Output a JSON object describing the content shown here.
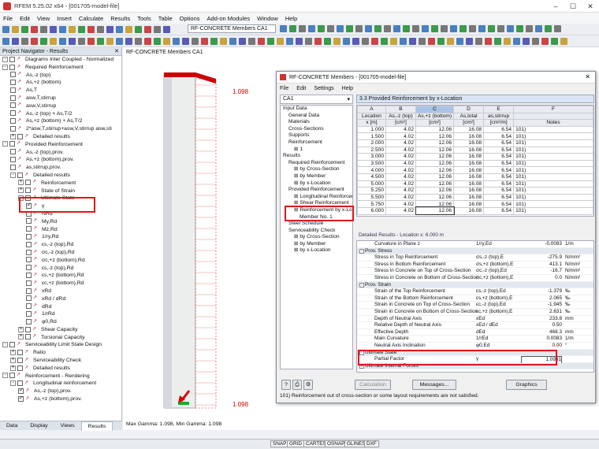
{
  "window": {
    "title": "RFEM 5.25.02 x64 - [001705-model-file]"
  },
  "menu": [
    "File",
    "Edit",
    "View",
    "Insert",
    "Calculate",
    "Results",
    "Tools",
    "Table",
    "Options",
    "Add-on Modules",
    "Window",
    "Help"
  ],
  "toolbar": {
    "module_combo": "RF-CONCRETE Members CA1"
  },
  "navigator": {
    "title": "Project Navigator - Results",
    "items": [
      {
        "d": 0,
        "exp": "-",
        "label": "Diagrams Inter Coupled - Normalized"
      },
      {
        "d": 0,
        "exp": "-",
        "label": "Required Reinforcement"
      },
      {
        "d": 1,
        "cb": false,
        "label": "As,-z (top)"
      },
      {
        "d": 1,
        "cb": false,
        "label": "As,+z (bottom)"
      },
      {
        "d": 1,
        "cb": false,
        "label": "As,T"
      },
      {
        "d": 1,
        "cb": false,
        "label": "asw,T,stirrup"
      },
      {
        "d": 1,
        "cb": false,
        "label": "asw,V,stirrup"
      },
      {
        "d": 1,
        "cb": false,
        "label": "As,-z (top) + As,T/2"
      },
      {
        "d": 1,
        "cb": false,
        "label": "As,+z (bottom) + As,T/2"
      },
      {
        "d": 1,
        "cb": false,
        "label": "2*asw,T,stirrup+asw,V,stirrup asw,sti"
      },
      {
        "d": 1,
        "exp": "+",
        "label": "Detailed results"
      },
      {
        "d": 0,
        "exp": "-",
        "label": "Provided Reinforcement"
      },
      {
        "d": 1,
        "cb": false,
        "label": "As,-z (top),prov."
      },
      {
        "d": 1,
        "cb": false,
        "label": "As,+z (bottom),prov."
      },
      {
        "d": 1,
        "cb": false,
        "label": "as,stirrup,prov."
      },
      {
        "d": 1,
        "exp": "-",
        "label": "Detailed results"
      },
      {
        "d": 2,
        "exp": "+",
        "label": "Reinforcement"
      },
      {
        "d": 2,
        "exp": "+",
        "label": "State of Strain"
      },
      {
        "d": 2,
        "exp": "-",
        "label": "Ultimate State"
      },
      {
        "d": 3,
        "cb": true,
        "label": "γ"
      },
      {
        "d": 3,
        "cb": false,
        "label": "NRd"
      },
      {
        "d": 3,
        "cb": false,
        "label": "My,Rd"
      },
      {
        "d": 3,
        "cb": false,
        "label": "Mz,Rd"
      },
      {
        "d": 3,
        "cb": false,
        "label": "1/ry,Rd"
      },
      {
        "d": 3,
        "cb": false,
        "label": "εs,-z (top),Rd"
      },
      {
        "d": 3,
        "cb": false,
        "label": "σc,-z (top),Rd"
      },
      {
        "d": 3,
        "cb": false,
        "label": "σc,+z (bottom),Rd"
      },
      {
        "d": 3,
        "cb": false,
        "label": "εs,-z (top),Rd"
      },
      {
        "d": 3,
        "cb": false,
        "label": "εs,+z (bottom),Rd"
      },
      {
        "d": 3,
        "cb": false,
        "label": "εc,+z (bottom),Rd"
      },
      {
        "d": 3,
        "cb": false,
        "label": "xRd"
      },
      {
        "d": 3,
        "cb": false,
        "label": "xRd / dRd"
      },
      {
        "d": 3,
        "cb": false,
        "label": "dRd"
      },
      {
        "d": 3,
        "cb": false,
        "label": "1/rRd"
      },
      {
        "d": 3,
        "cb": false,
        "label": "φ0,Rd"
      },
      {
        "d": 2,
        "exp": "+",
        "label": "Shear Capacity"
      },
      {
        "d": 2,
        "exp": "+",
        "label": "Torsional Capacity"
      },
      {
        "d": 0,
        "exp": "-",
        "label": "Serviceability Limit State Design"
      },
      {
        "d": 1,
        "exp": "+",
        "label": "Ratio"
      },
      {
        "d": 1,
        "exp": "+",
        "label": "Serviceability Check"
      },
      {
        "d": 1,
        "exp": "+",
        "label": "Detailed results"
      },
      {
        "d": 0,
        "exp": "-",
        "label": "Reinforcement - Rendering"
      },
      {
        "d": 1,
        "exp": "-",
        "label": "Longitudinal reinforcement"
      },
      {
        "d": 2,
        "cb": true,
        "label": "As,-z (top),prov."
      },
      {
        "d": 2,
        "cb": true,
        "label": "As,+z (bottom),prov."
      }
    ],
    "tabs": [
      "Data",
      "Display",
      "Views",
      "Results"
    ]
  },
  "workspace": {
    "label": "RF-CONCRETE Members CA1",
    "top_value": "1.098",
    "bottom_value": "1.098",
    "footer": "Max Gamma: 1.098, Min Gamma: 1.098"
  },
  "dialog": {
    "title": "RF-CONCRETE Members - [001705-model-file]",
    "menu": [
      "File",
      "Edit",
      "Settings",
      "Help"
    ],
    "case": "CA1",
    "tree": [
      {
        "d": 0,
        "t": "Input Data"
      },
      {
        "d": 1,
        "t": "General Data"
      },
      {
        "d": 1,
        "t": "Materials"
      },
      {
        "d": 1,
        "t": "Cross-Sections"
      },
      {
        "d": 1,
        "t": "Supports"
      },
      {
        "d": 1,
        "t": "Reinforcement"
      },
      {
        "d": 2,
        "t": "1"
      },
      {
        "d": 0,
        "t": "Results"
      },
      {
        "d": 1,
        "t": "Required Reinforcement"
      },
      {
        "d": 2,
        "t": "by Cross-Section"
      },
      {
        "d": 2,
        "t": "by Member"
      },
      {
        "d": 2,
        "t": "by x-Location"
      },
      {
        "d": 1,
        "t": "Provided Reinforcement"
      },
      {
        "d": 2,
        "t": "Longitudinal Reinforcement"
      },
      {
        "d": 2,
        "t": "Shear Reinforcement"
      },
      {
        "d": 2,
        "t": "Reinforcement by x-Locatio"
      },
      {
        "d": 3,
        "t": "Member No. 1"
      },
      {
        "d": 1,
        "t": "Steel Schedule"
      },
      {
        "d": 1,
        "t": "Serviceability Check"
      },
      {
        "d": 2,
        "t": "by Cross-Section"
      },
      {
        "d": 2,
        "t": "by Member"
      },
      {
        "d": 2,
        "t": "by x-Location"
      }
    ],
    "table_title": "3.3 Provided Reinforcement by x-Location",
    "col_letters": [
      "A",
      "B",
      "C",
      "D",
      "E",
      "F"
    ],
    "col_headers": [
      [
        "Location",
        "x [m]"
      ],
      [
        "As,-z (top)",
        "[cm²]"
      ],
      [
        "As,+z (bottom)",
        "[cm²]"
      ],
      [
        "As,total",
        "[cm²]"
      ],
      [
        "as,stirrup",
        "[cm²/m]"
      ],
      [
        "",
        "Notes"
      ]
    ],
    "rows": [
      [
        "1.000",
        "4.02",
        "12.06",
        "16.08",
        "6.54",
        "101)"
      ],
      [
        "1.500",
        "4.02",
        "12.06",
        "16.08",
        "6.54",
        "101)"
      ],
      [
        "2.000",
        "4.02",
        "12.06",
        "16.08",
        "6.54",
        "101)"
      ],
      [
        "2.500",
        "4.02",
        "12.06",
        "16.08",
        "6.54",
        "101)"
      ],
      [
        "3.000",
        "4.02",
        "12.06",
        "16.08",
        "6.54",
        "101)"
      ],
      [
        "3.500",
        "4.02",
        "12.06",
        "16.08",
        "6.54",
        "101)"
      ],
      [
        "4.000",
        "4.02",
        "12.06",
        "16.08",
        "6.54",
        "101)"
      ],
      [
        "4.500",
        "4.02",
        "12.06",
        "16.08",
        "6.54",
        "101)"
      ],
      [
        "5.000",
        "4.02",
        "12.06",
        "16.08",
        "6.54",
        "101)"
      ],
      [
        "5.250",
        "4.02",
        "12.06",
        "16.08",
        "6.54",
        "101)"
      ],
      [
        "5.500",
        "4.02",
        "12.06",
        "16.08",
        "6.54",
        "101)"
      ],
      [
        "5.750",
        "4.02",
        "12.06",
        "16.08",
        "6.54",
        "101)"
      ],
      [
        "6.000",
        "4.02",
        "12.06",
        "16.08",
        "6.54",
        "101)"
      ]
    ],
    "details_header": "Detailed Results  -  Location x: 6.000 m",
    "details": [
      {
        "g": false,
        "n": "Curvature in Plane z",
        "s": "1/ry,Ed",
        "v": "-0.0083",
        "u": "1/m"
      },
      {
        "g": true,
        "n": "Prov. Stress"
      },
      {
        "g": false,
        "n": "Stress in Top Reinforcement",
        "s": "σs,-z (top),E",
        "v": "-275.9",
        "u": "N/mm²"
      },
      {
        "g": false,
        "n": "Stress in Bottom Reinforcement",
        "s": "σs,+z (bottom),E",
        "v": "413.1",
        "u": "N/mm²"
      },
      {
        "g": false,
        "n": "Stress in Concrete on Top of Cross-Section",
        "s": "σc,-z (top),Ed",
        "v": "-16.7",
        "u": "N/mm²"
      },
      {
        "g": false,
        "n": "Stress in Concrete on Bottom of Cross-Section",
        "s": "σc,+z (bottom),E",
        "v": "0.0",
        "u": "N/mm²"
      },
      {
        "g": true,
        "n": "Prov. Strain"
      },
      {
        "g": false,
        "n": "Strain of the Top Reinforcement",
        "s": "εs,-z (top),Ed",
        "v": "-1.379",
        "u": "‰"
      },
      {
        "g": false,
        "n": "Strain of the Bottom Reinforcement",
        "s": "εs,+z (bottom),E",
        "v": "2.065",
        "u": "‰"
      },
      {
        "g": false,
        "n": "Strain in Concrete on Top of Cross-Section",
        "s": "εc,-z (top),Ed",
        "v": "-1.945",
        "u": "‰"
      },
      {
        "g": false,
        "n": "Strain in Concrete on Bottom of Cross-Section",
        "s": "εc,+z (bottom),E",
        "v": "2.631",
        "u": "‰"
      },
      {
        "g": false,
        "n": "Depth of Neutral Axis",
        "s": "xEd",
        "v": "233.8",
        "u": "mm"
      },
      {
        "g": false,
        "n": "Relative Depth of Neutral Axis",
        "s": "xEd / dEd",
        "v": "0.50",
        "u": ""
      },
      {
        "g": false,
        "n": "Effective Depth",
        "s": "dEd",
        "v": "468.3",
        "u": "mm"
      },
      {
        "g": false,
        "n": "Main Curvature",
        "s": "1/rEd",
        "v": "0.0083",
        "u": "1/m"
      },
      {
        "g": false,
        "n": "Neutral Axis Inclination",
        "s": "φ0,Ed",
        "v": "0.00",
        "u": "°"
      },
      {
        "g": true,
        "n": "Ultimate State"
      },
      {
        "g": false,
        "n": "Partial Factor",
        "s": "γ",
        "v": "1.0981",
        "u": ""
      },
      {
        "g": true,
        "n": "Ultimate Internal Forces",
        "closed": true
      }
    ],
    "buttons": {
      "calculation": "Calculation",
      "messages": "Messages...",
      "graphics": "Graphics"
    },
    "message": "101) Reinforcement out of cross-section or some layout requirements are not satisfied."
  },
  "statusbar": [
    "SNAP",
    "GRID",
    "CARTES",
    "OSNAP",
    "GLINES",
    "DXF"
  ]
}
